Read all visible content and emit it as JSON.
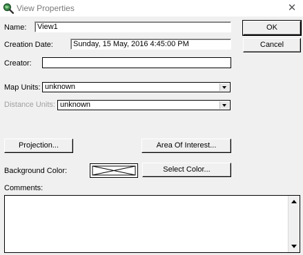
{
  "window": {
    "title": "View Properties",
    "icon": "magnifier-globe-icon",
    "close_icon": "close-icon"
  },
  "form": {
    "name_label": "Name:",
    "name_value": "View1",
    "creation_date_label": "Creation Date:",
    "creation_date_value": "Sunday, 15 May, 2016 4:45:00 PM",
    "creator_label": "Creator:",
    "creator_value": "",
    "map_units_label": "Map Units:",
    "map_units_value": "unknown",
    "distance_units_label": "Distance Units:",
    "distance_units_value": "unknown",
    "background_color_label": "Background Color:",
    "comments_label": "Comments:",
    "comments_value": ""
  },
  "buttons": {
    "ok": "OK",
    "cancel": "Cancel",
    "projection": "Projection...",
    "area_of_interest": "Area Of Interest...",
    "select_color": "Select Color..."
  },
  "colors": {
    "background_color_swatch": "none"
  }
}
